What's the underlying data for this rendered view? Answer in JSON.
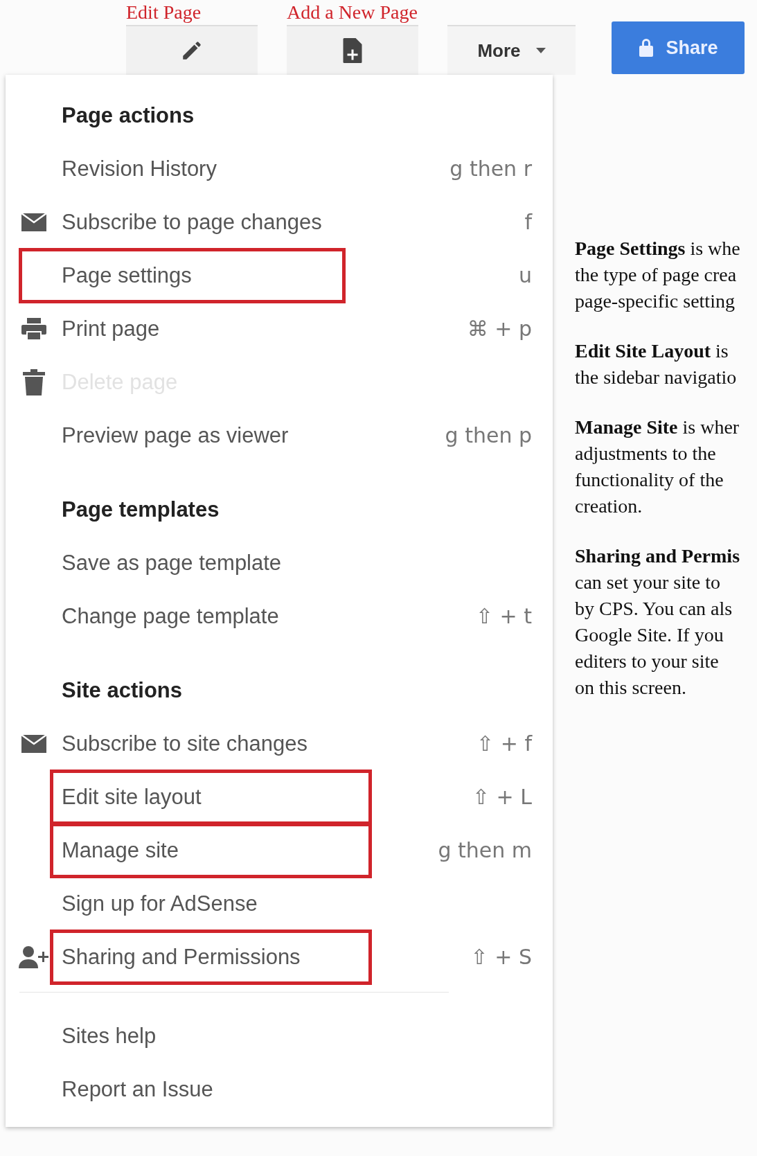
{
  "toolbar": {
    "buttons": [
      {
        "kind": "edit",
        "annotation": "Edit Page"
      },
      {
        "kind": "new-page",
        "annotation": "Add a New Page"
      },
      {
        "kind": "more",
        "label": "More"
      }
    ],
    "share": {
      "label": "Share"
    }
  },
  "menu": [
    {
      "kind": "header",
      "label": "Page actions"
    },
    {
      "kind": "item",
      "label": "Revision History",
      "shortcut": "g then r",
      "disabled": false,
      "highlighted": false
    },
    {
      "kind": "envelope",
      "label": "Subscribe to page changes",
      "shortcut": "f",
      "disabled": false,
      "highlighted": false
    },
    {
      "kind": "item",
      "label": "Page settings",
      "shortcut": "u",
      "disabled": false,
      "highlighted": true
    },
    {
      "kind": "printer",
      "label": "Print page",
      "shortcut": "⌘ + p",
      "disabled": false,
      "highlighted": false
    },
    {
      "kind": "trash",
      "label": "Delete page",
      "disabled": true,
      "highlighted": false
    },
    {
      "kind": "item",
      "label": "Preview page as viewer",
      "shortcut": "g then p",
      "disabled": false,
      "highlighted": false
    },
    {
      "kind": "header",
      "label": "Page templates"
    },
    {
      "kind": "item",
      "label": "Save as page template",
      "disabled": false,
      "highlighted": false
    },
    {
      "kind": "item",
      "label": "Change page template",
      "shortcut": "⇧ + t",
      "disabled": false,
      "highlighted": false
    },
    {
      "kind": "header",
      "label": "Site actions"
    },
    {
      "kind": "envelope",
      "label": "Subscribe to site changes",
      "shortcut": "⇧ + f",
      "disabled": false,
      "highlighted": false
    },
    {
      "kind": "item",
      "label": "Edit site layout",
      "shortcut": "⇧ + L",
      "disabled": false,
      "highlighted": true
    },
    {
      "kind": "item",
      "label": "Manage site",
      "shortcut": "g then m",
      "disabled": false,
      "highlighted": true
    },
    {
      "kind": "item",
      "label": "Sign up for AdSense",
      "disabled": false,
      "highlighted": false
    },
    {
      "kind": "person",
      "label": "Sharing and Permissions",
      "shortcut": "⇧ + S",
      "disabled": false,
      "highlighted": true
    },
    {
      "kind": "separator"
    },
    {
      "kind": "item",
      "label": "Sites help",
      "disabled": false,
      "highlighted": false
    },
    {
      "kind": "item",
      "label": "Report an Issue",
      "disabled": false,
      "highlighted": false
    }
  ],
  "notes": [
    {
      "lines": [
        "**Page Settings** is whe",
        "the type of page crea",
        "page-specific setting"
      ]
    },
    {
      "lines": [
        "**Edit Site Layout** is",
        "the sidebar navigatio"
      ]
    },
    {
      "lines": [
        "**Manage Site** is wher",
        "adjustments to the",
        "functionality of the",
        "creation."
      ]
    },
    {
      "lines": [
        "**Sharing and Permis**",
        "can set your site to",
        "by CPS. You can als",
        "Google Site. If you",
        "editers to your site",
        "on this screen."
      ]
    }
  ]
}
